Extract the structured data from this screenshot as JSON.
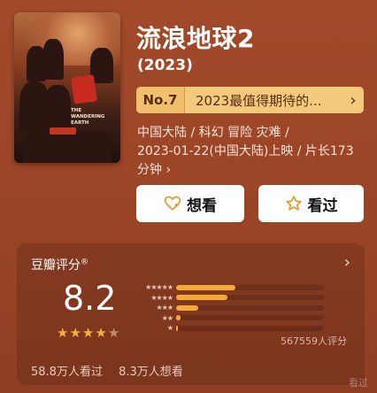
{
  "movie": {
    "title": "流浪地球2",
    "year": "(2023)",
    "rank_no": "No.7",
    "rank_text": "2023最值得期待的...",
    "info_line1": "中国大陆 / 科幻 冒险 灾难 /",
    "info_line2": "2023-01-22(中国大陆)上映 / 片长173",
    "info_line3": "分钟 ›"
  },
  "poster": {
    "title_text": "THE WANDERING EARTH"
  },
  "buttons": {
    "want_label": "想看",
    "seen_label": "看过"
  },
  "rating": {
    "title": "豆瓣评分",
    "registered_mark": "®",
    "score": "8.2",
    "stars_filled": 4,
    "count_text": "567559人评分",
    "distribution_percent": [
      40,
      35,
      15,
      3,
      1
    ],
    "seen_text": "58.8万人看过",
    "want_text": "8.3万人想看"
  },
  "watermark": "看过"
}
